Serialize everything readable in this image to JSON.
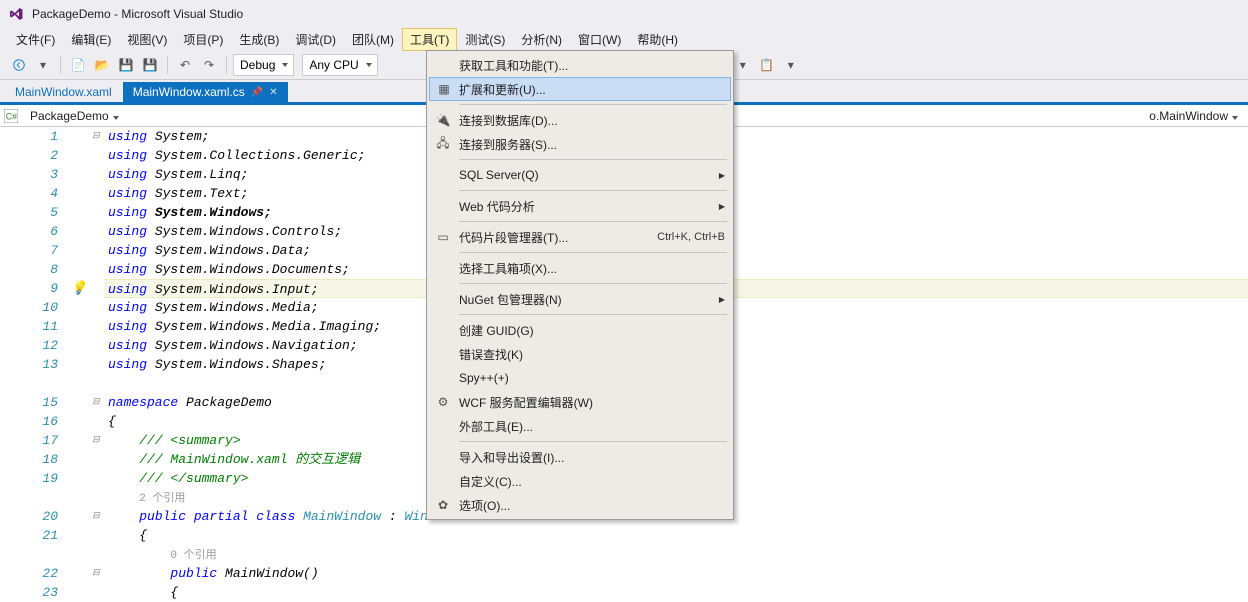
{
  "title": "PackageDemo - Microsoft Visual Studio",
  "menubar": {
    "items": [
      "文件(F)",
      "编辑(E)",
      "视图(V)",
      "项目(P)",
      "生成(B)",
      "调试(D)",
      "团队(M)",
      "工具(T)",
      "测试(S)",
      "分析(N)",
      "窗口(W)",
      "帮助(H)"
    ],
    "open_index": 7
  },
  "toolbar": {
    "config": "Debug",
    "platform": "Any CPU"
  },
  "tabs": {
    "items": [
      {
        "label": "MainWindow.xaml",
        "active": false
      },
      {
        "label": "MainWindow.xaml.cs",
        "active": true
      }
    ]
  },
  "breadcrumb": {
    "left": "PackageDemo",
    "right": "o.MainWindow"
  },
  "dropdown": {
    "items": [
      {
        "label": "获取工具和功能(T)...",
        "type": "item"
      },
      {
        "label": "扩展和更新(U)...",
        "type": "item",
        "hover": true,
        "icon": "ext"
      },
      {
        "type": "sep"
      },
      {
        "label": "连接到数据库(D)...",
        "type": "item",
        "icon": "db"
      },
      {
        "label": "连接到服务器(S)...",
        "type": "item",
        "icon": "srv"
      },
      {
        "type": "sep"
      },
      {
        "label": "SQL Server(Q)",
        "type": "submenu"
      },
      {
        "type": "sep"
      },
      {
        "label": "Web 代码分析",
        "type": "submenu"
      },
      {
        "type": "sep"
      },
      {
        "label": "代码片段管理器(T)...",
        "type": "item",
        "icon": "snip",
        "shortcut": "Ctrl+K, Ctrl+B"
      },
      {
        "type": "sep"
      },
      {
        "label": "选择工具箱项(X)...",
        "type": "item"
      },
      {
        "type": "sep"
      },
      {
        "label": "NuGet 包管理器(N)",
        "type": "submenu"
      },
      {
        "type": "sep"
      },
      {
        "label": "创建 GUID(G)",
        "type": "item"
      },
      {
        "label": "错误查找(K)",
        "type": "item"
      },
      {
        "label": "Spy++(+)",
        "type": "item"
      },
      {
        "label": "WCF 服务配置编辑器(W)",
        "type": "item",
        "icon": "wcf"
      },
      {
        "label": "外部工具(E)...",
        "type": "item"
      },
      {
        "type": "sep"
      },
      {
        "label": "导入和导出设置(I)...",
        "type": "item"
      },
      {
        "label": "自定义(C)...",
        "type": "item"
      },
      {
        "label": "选项(O)...",
        "type": "item",
        "icon": "gear"
      }
    ]
  },
  "code": {
    "lines": [
      {
        "n": 1,
        "fold": "-",
        "html": "<span class='kw'>using</span> System;"
      },
      {
        "n": 2,
        "html": "<span class='kw'>using</span> System.Collections.Generic;"
      },
      {
        "n": 3,
        "html": "<span class='kw'>using</span> System.Linq;"
      },
      {
        "n": 4,
        "html": "<span class='kw'>using</span> System.Text;"
      },
      {
        "n": 5,
        "html": "<span class='kw'>using</span> <span style='font-weight:bold'>System.Windows;</span>"
      },
      {
        "n": 6,
        "html": "<span class='kw'>using</span> System.Windows.Controls;"
      },
      {
        "n": 7,
        "html": "<span class='kw'>using</span> System.Windows.Data;"
      },
      {
        "n": 8,
        "html": "<span class='kw'>using</span> System.Windows.Documents;"
      },
      {
        "n": 9,
        "bulb": true,
        "hl": true,
        "html": "<span class='kw'>using</span> System.Windows.Input;"
      },
      {
        "n": 10,
        "html": "<span class='kw'>using</span> System.Windows.Media;"
      },
      {
        "n": 11,
        "html": "<span class='kw'>using</span> System.Windows.Media.Imaging;"
      },
      {
        "n": 12,
        "html": "<span class='kw'>using</span> System.Windows.Navigation;"
      },
      {
        "n": 13,
        "html": "<span class='kw'>using</span> System.Windows.Shapes;"
      },
      {
        "n": "",
        "html": ""
      },
      {
        "n": 15,
        "fold": "-",
        "html": "<span class='kw'>namespace</span> PackageDemo"
      },
      {
        "n": 16,
        "html": "{"
      },
      {
        "n": 17,
        "fold": "-",
        "html": "    <span class='cmt'>/// &lt;summary&gt;</span>"
      },
      {
        "n": 18,
        "html": "    <span class='cmt'>/// MainWindow.xaml 的交互逻辑</span>"
      },
      {
        "n": 19,
        "html": "    <span class='cmt'>/// &lt;/summary&gt;</span>"
      },
      {
        "n": "",
        "html": "    <span class='ref-txt'>2 个引用</span>"
      },
      {
        "n": 20,
        "fold": "-",
        "html": "    <span class='kw'>public partial class</span> <span class='cls'>MainWindow</span> : <span class='cls'>Window</span>"
      },
      {
        "n": 21,
        "html": "    {"
      },
      {
        "n": "",
        "html": "        <span class='ref-txt'>0 个引用</span>"
      },
      {
        "n": 22,
        "fold": "-",
        "html": "        <span class='kw'>public</span> MainWindow()"
      },
      {
        "n": 23,
        "html": "        {"
      }
    ]
  }
}
